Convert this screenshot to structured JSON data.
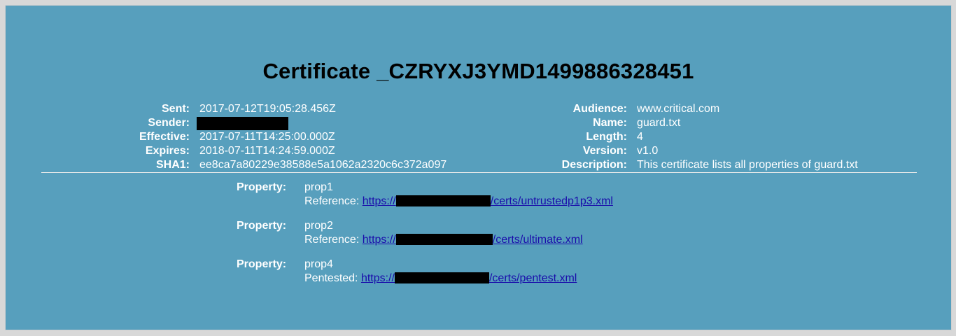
{
  "title": "Certificate _CZRYXJ3YMD1499886328451",
  "left_meta": [
    {
      "label": "Sent:",
      "value": "2017-07-12T19:05:28.456Z"
    },
    {
      "label": "Sender:",
      "value": ""
    },
    {
      "label": "Effective:",
      "value": "2017-07-11T14:25:00.000Z"
    },
    {
      "label": "Expires:",
      "value": "2018-07-11T14:24:59.000Z"
    },
    {
      "label": "SHA1:",
      "value": "ee8ca7a80229e38588e5a1062a2320c6c372a097"
    }
  ],
  "right_meta": [
    {
      "label": "Audience:",
      "value": "www.critical.com"
    },
    {
      "label": "Name:",
      "value": "guard.txt"
    },
    {
      "label": "Length:",
      "value": "4"
    },
    {
      "label": "Version:",
      "value": "v1.0"
    },
    {
      "label": "Description:",
      "value": "This certificate lists all properties of guard.txt"
    }
  ],
  "properties": [
    {
      "label": "Property:",
      "name": "prop1",
      "ref_label": "Reference:",
      "link_prefix": "https://",
      "link_suffix": "/certs/untrustedp1p3.xml"
    },
    {
      "label": "Property:",
      "name": "prop2",
      "ref_label": "Reference:",
      "link_prefix": "https://",
      "link_suffix": "/certs/ultimate.xml"
    },
    {
      "label": "Property:",
      "name": "prop4",
      "ref_label": "Pentested:",
      "link_prefix": "https://",
      "link_suffix": "/certs/pentest.xml"
    }
  ]
}
